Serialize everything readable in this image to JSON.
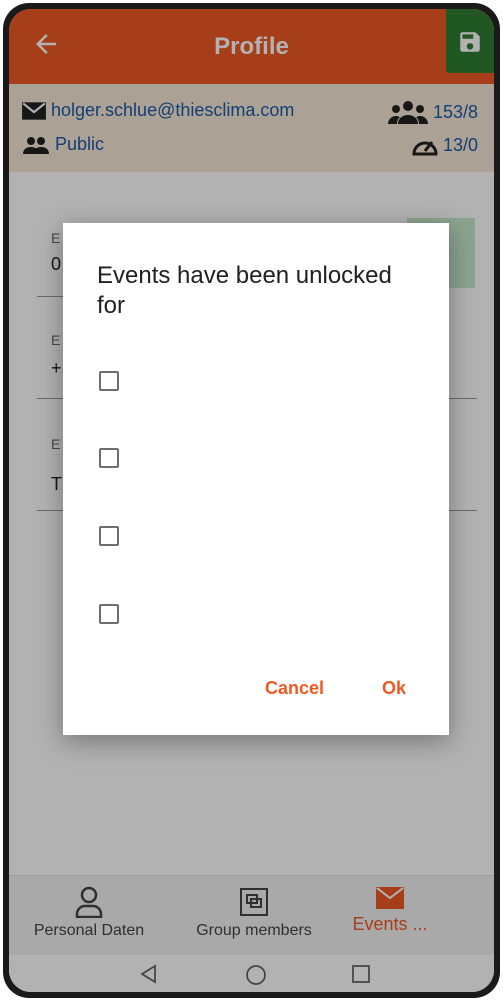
{
  "appbar": {
    "title": "Profile"
  },
  "info": {
    "email": "holger.schlue@thiesclima.com",
    "visibility": "Public",
    "members_count": "153/8",
    "speed_count": "13/0"
  },
  "dialog": {
    "title": "Events have been unlocked for",
    "cancel_label": "Cancel",
    "ok_label": "Ok"
  },
  "background_fields": {
    "field1_label": "E",
    "field1_value": "0",
    "field2_label": "E",
    "field2_value": "+",
    "field3_label": "E",
    "field3_value": "T"
  },
  "bottom_nav": {
    "personal": "Personal Daten",
    "group": "Group members",
    "events": "Events ..."
  },
  "colors": {
    "accent": "#ee5a24",
    "save_green": "#2e7d32",
    "link_blue": "#1e5aa8",
    "info_bg": "#f5e9d6"
  }
}
